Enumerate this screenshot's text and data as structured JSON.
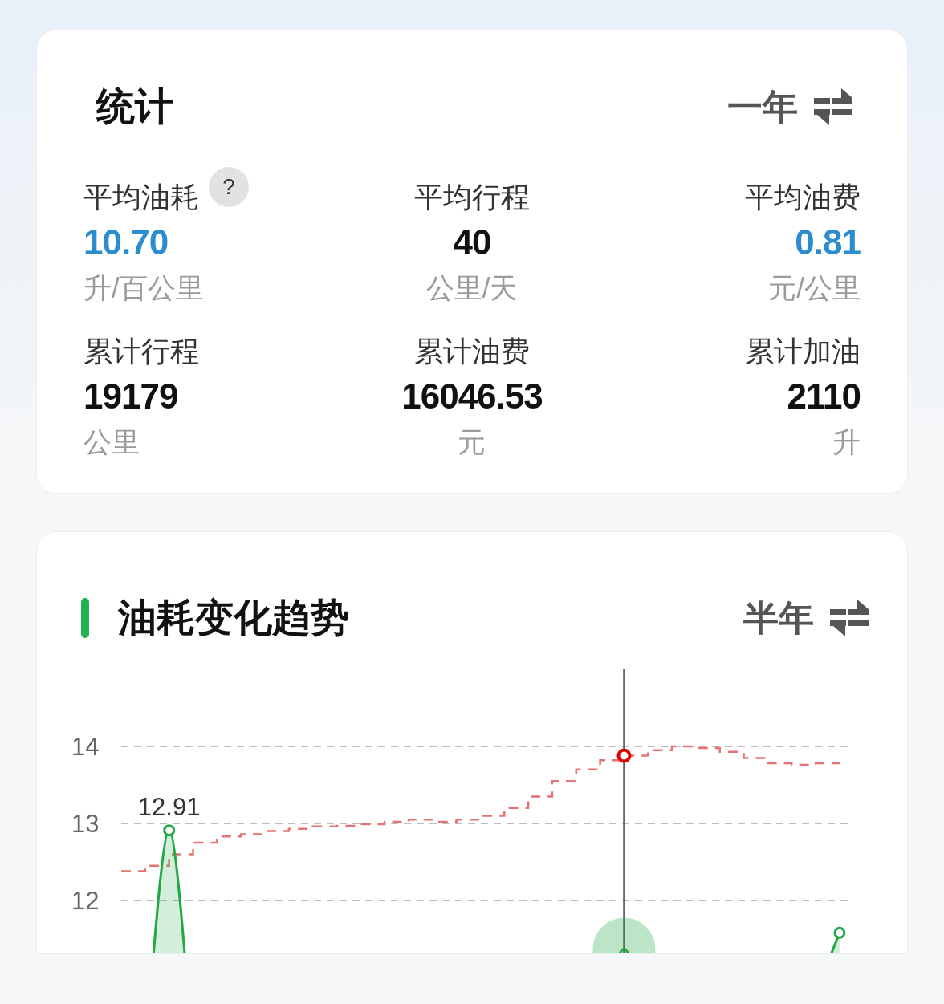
{
  "stats_card": {
    "title": "统计",
    "period": "一年",
    "stats": [
      {
        "label": "平均油耗",
        "value": "10.70",
        "unit": "升/百公里",
        "highlight": true,
        "help": "?"
      },
      {
        "label": "平均行程",
        "value": "40",
        "unit": "公里/天",
        "highlight": false
      },
      {
        "label": "平均油费",
        "value": "0.81",
        "unit": "元/公里",
        "highlight": true
      },
      {
        "label": "累计行程",
        "value": "19179",
        "unit": "公里",
        "highlight": false
      },
      {
        "label": "累计油费",
        "value": "16046.53",
        "unit": "元",
        "highlight": false
      },
      {
        "label": "累计加油",
        "value": "2110",
        "unit": "升",
        "highlight": false
      }
    ]
  },
  "trend_card": {
    "title": "油耗变化趋势",
    "period": "半年",
    "chart": {
      "kind": "picture",
      "y_ticks": [
        "14",
        "13",
        "12"
      ],
      "peak_label": "12.91"
    }
  }
}
